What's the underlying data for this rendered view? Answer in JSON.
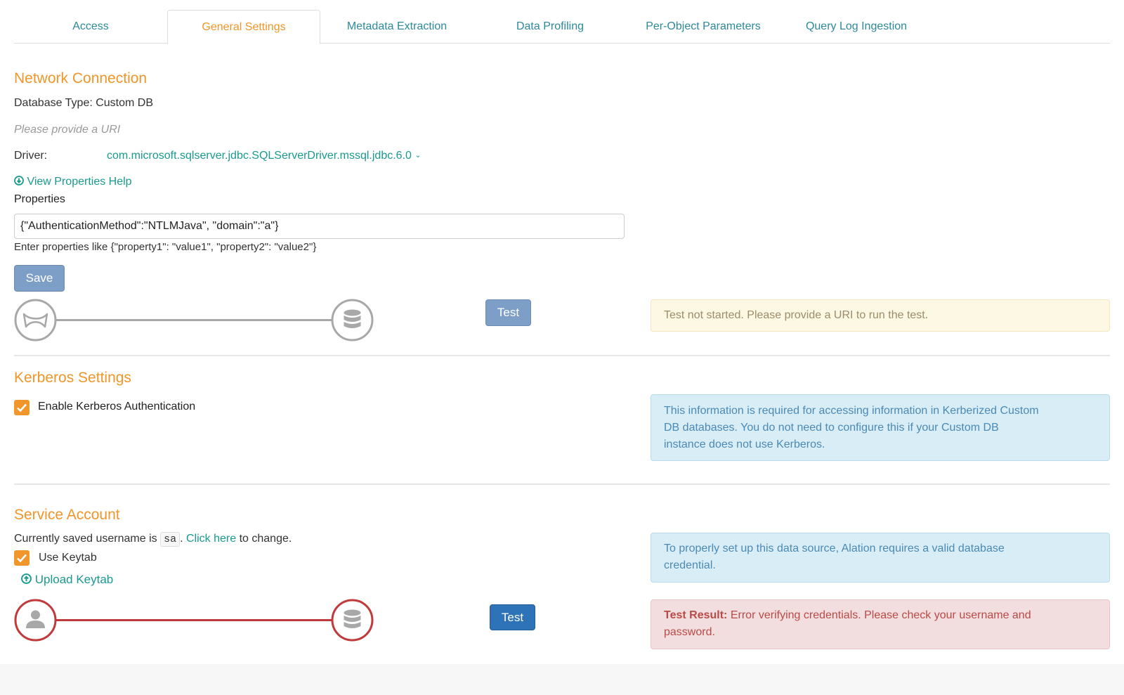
{
  "tabs": [
    {
      "label": "Access",
      "active": false
    },
    {
      "label": "General Settings",
      "active": true
    },
    {
      "label": "Metadata Extraction",
      "active": false
    },
    {
      "label": "Data Profiling",
      "active": false
    },
    {
      "label": "Per-Object Parameters",
      "active": false
    },
    {
      "label": "Query Log Ingestion",
      "active": false
    }
  ],
  "network": {
    "title": "Network Connection",
    "db_type": "Database Type: Custom DB",
    "uri_placeholder": "Please provide a URI",
    "driver_label": "Driver:",
    "driver_value": "com.microsoft.sqlserver.jdbc.SQLServerDriver.mssql.jdbc.6.0",
    "view_help": "View Properties Help",
    "properties_label": "Properties",
    "properties_value": "{\"AuthenticationMethod\":\"NTLMJava\", \"domain\":\"a\"}",
    "properties_hint": "Enter properties like {\"property1\": \"value1\", \"property2\": \"value2\"}",
    "save_label": "Save",
    "test_label": "Test",
    "test_status": "Test not started. Please provide a URI to run the test."
  },
  "kerberos": {
    "title": "Kerberos Settings",
    "enable_label": "Enable Kerberos Authentication",
    "enabled": true,
    "info_line1": "This information is required for accessing information in Kerberized Custom",
    "info_line2": "DB databases. You do not need to configure this if your Custom DB",
    "info_line3": "instance does not use Kerberos."
  },
  "service_account": {
    "title": "Service Account",
    "saved_prefix": "Currently saved username is",
    "username": "sa",
    "click_here": "Click here",
    "saved_suffix": "to change.",
    "use_keytab_label": "Use Keytab",
    "use_keytab": true,
    "upload_keytab": "Upload Keytab",
    "test_label": "Test",
    "info_line1": "To properly set up this data source, Alation requires a valid database",
    "info_line2": "credential.",
    "result_label": "Test Result:",
    "result_line1": "Error verifying credentials. Please check your username and",
    "result_line2": "password."
  },
  "colors": {
    "accent_orange": "#f0962a",
    "link_teal": "#1a9a8f",
    "error_red": "#c0393b"
  }
}
